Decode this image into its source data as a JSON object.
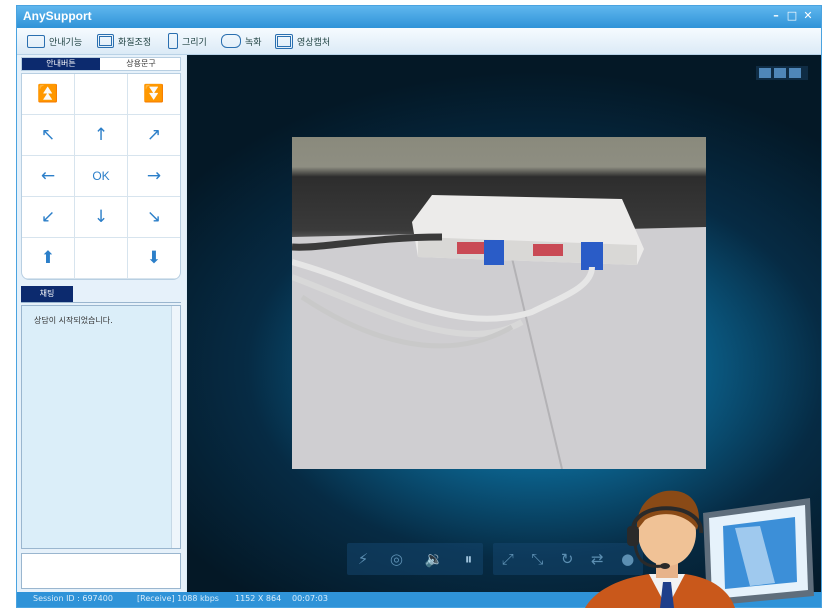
{
  "window": {
    "title": "AnySupport"
  },
  "toolbar": {
    "guide": "안내기능",
    "quality": "화질조정",
    "draw": "그리기",
    "record": "녹화",
    "capture": "영상캡처"
  },
  "left_panel": {
    "tabs": [
      "안내버튼",
      "상용문구"
    ],
    "keypad_ok": "OK",
    "chat_tab": "채팅",
    "chat_message": "상담이 시작되었습니다."
  },
  "status": {
    "session": "Session ID : 697400",
    "receive": "[Receive] 1088 kbps",
    "resolution": "1152 X 864",
    "time": "00:07:03"
  },
  "colors": {
    "accent": "#2f93d8",
    "tab_active": "#0c2a6e"
  }
}
